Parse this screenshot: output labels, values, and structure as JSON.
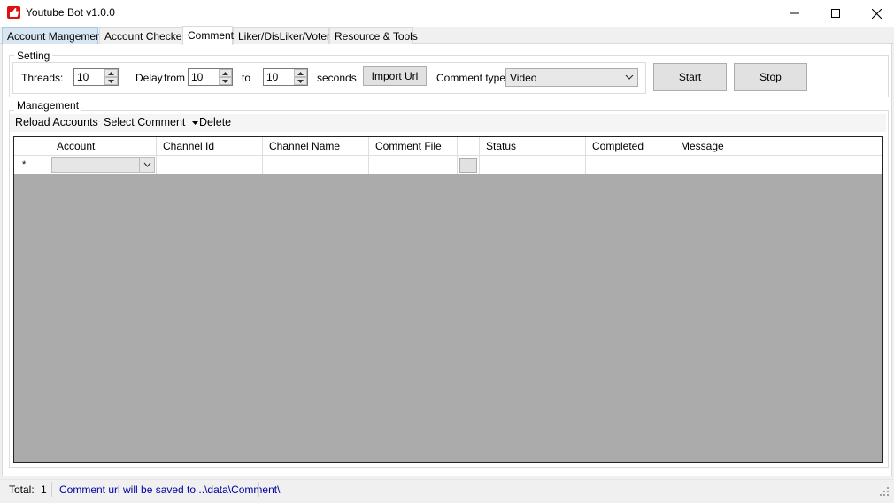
{
  "window": {
    "title": "Youtube Bot v1.0.0",
    "app_icon": "youtube-like-icon",
    "controls": {
      "minimize_icon": "minimize-icon",
      "maximize_icon": "maximize-icon",
      "close_icon": "close-icon"
    }
  },
  "tabs": [
    {
      "label": "Account Mangement"
    },
    {
      "label": "Account Checker"
    },
    {
      "label": "Comment"
    },
    {
      "label": "Liker/DisLiker/Voter"
    },
    {
      "label": "Resource & Tools"
    }
  ],
  "setting": {
    "legend": "Setting",
    "threads_label": "Threads:",
    "threads_value": "10",
    "delay_label": "Delay",
    "from_label": "from",
    "delay_from_value": "10",
    "to_label": "to",
    "delay_to_value": "10",
    "seconds_label": "seconds",
    "import_button": "Import Url",
    "comment_type_label": "Comment type",
    "comment_type_value": "Video"
  },
  "actions": {
    "start": "Start",
    "stop": "Stop"
  },
  "management": {
    "legend": "Management",
    "toolbar": {
      "reload": "Reload Accounts",
      "select_comment": "Select Comment",
      "delete": "Delete"
    }
  },
  "grid": {
    "columns": [
      "Account",
      "Channel Id",
      "Channel Name",
      "Comment File",
      "",
      "Status",
      "Completed",
      "Message"
    ],
    "new_row_marker": "*"
  },
  "status": {
    "total_label": "Total:",
    "total_value": "1",
    "message": "Comment url will be saved to ..\\data\\Comment\\"
  },
  "colors": {
    "accent_blue": "#0000a0",
    "grid_bg": "#ababab",
    "tab_hover": "#d8e6f2",
    "icon_red": "#e01010"
  }
}
